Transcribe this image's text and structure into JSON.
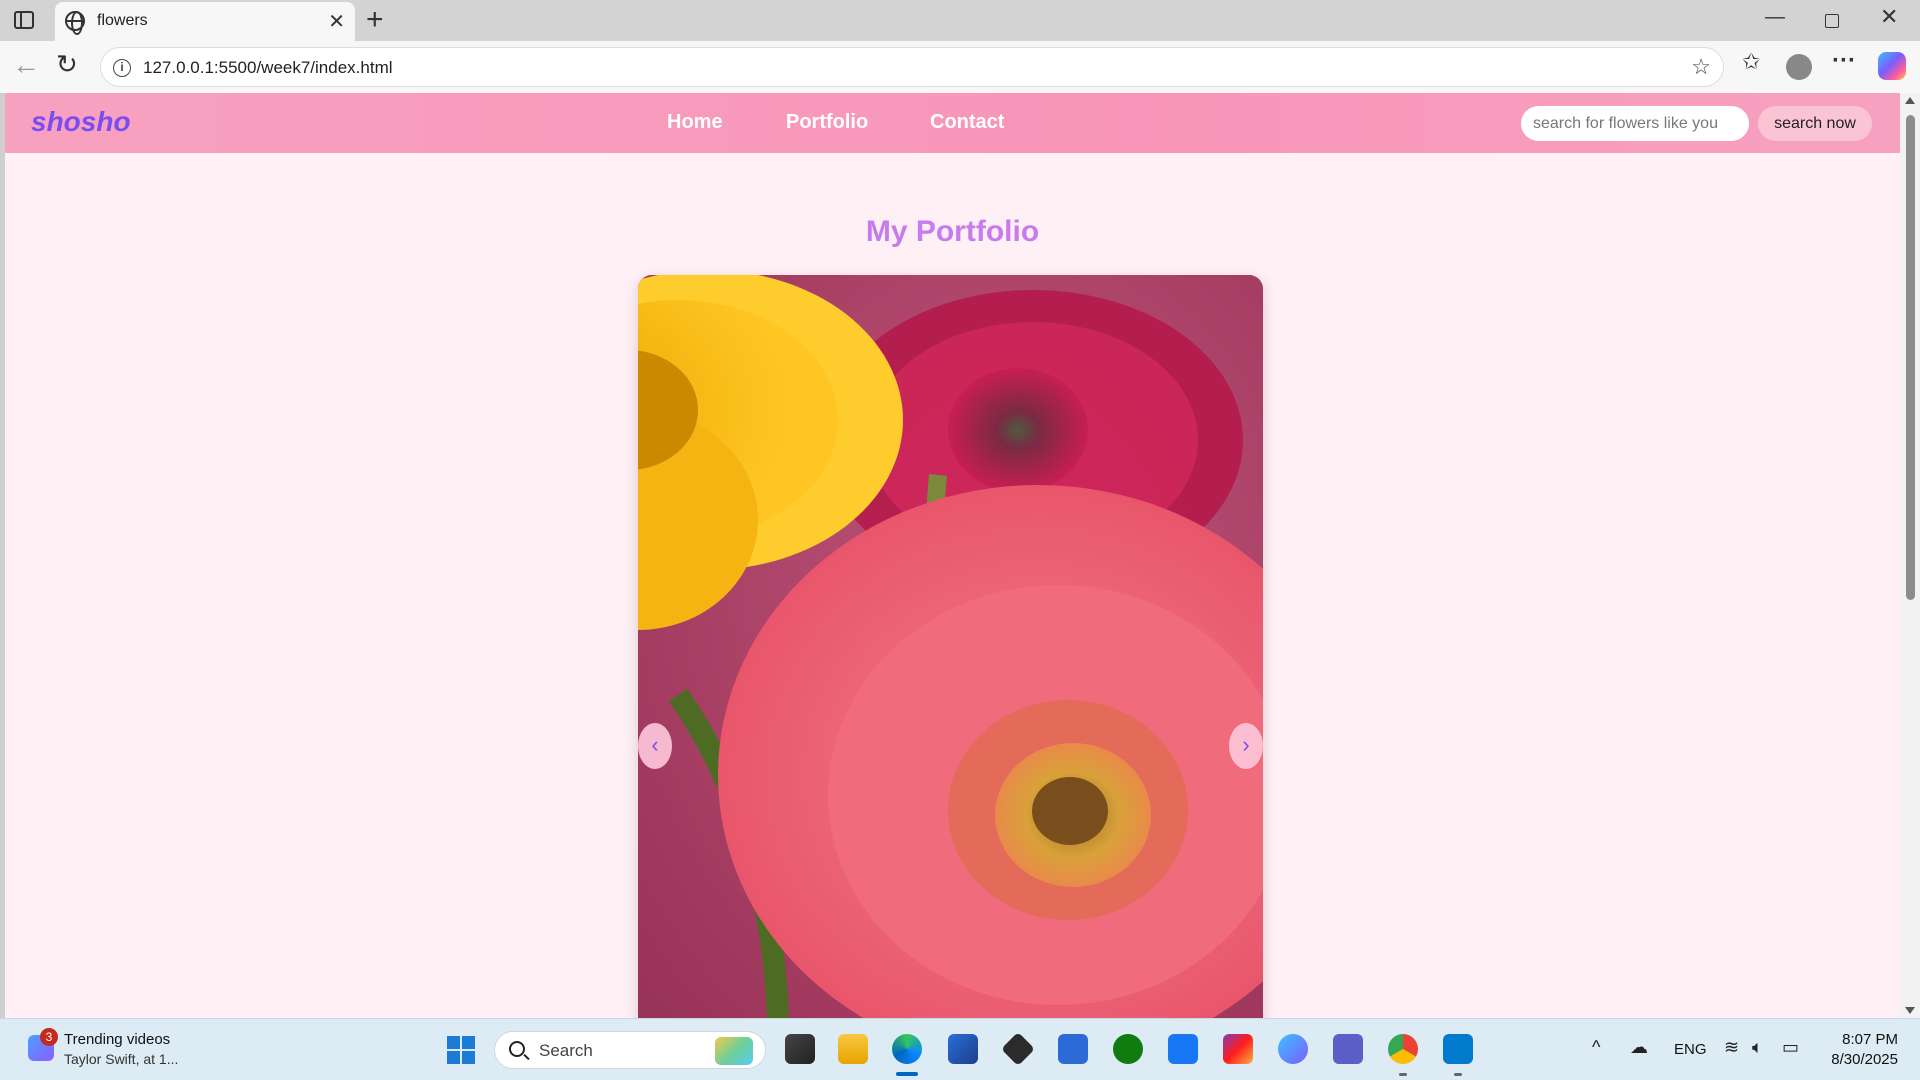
{
  "browser": {
    "tab_title": "flowers",
    "url": "127.0.0.1:5500/week7/index.html",
    "new_tab_symbol": "+",
    "close_symbol": "✕"
  },
  "site": {
    "logo": "shosho",
    "nav": [
      "Home",
      "Portfolio",
      "Contact"
    ],
    "search_placeholder": "search for flowers like you",
    "search_button": "search now",
    "section_title": "My Portfolio",
    "slider": {
      "prev_label": "‹",
      "next_label": "›",
      "image_subject": "yellow, pink and magenta gerbera daisies on a pink background"
    },
    "colors": {
      "header_bg": "#f895b8",
      "logo": "#7b4df0",
      "title": "#c77bee",
      "page_bg": "#fff0f5"
    }
  },
  "taskbar": {
    "widget_badge": "3",
    "widget_title": "Trending videos",
    "widget_subtitle": "Taylor Swift, at 1...",
    "search_label": "Search",
    "apps": [
      "task-view",
      "file-explorer",
      "edge",
      "microsoft-store",
      "unity",
      "visual-studio",
      "xbox",
      "facebook",
      "instagram",
      "copilot-app",
      "teams",
      "chrome",
      "vscode"
    ],
    "language": "ENG",
    "time": "8:07 PM",
    "date": "8/30/2025"
  }
}
